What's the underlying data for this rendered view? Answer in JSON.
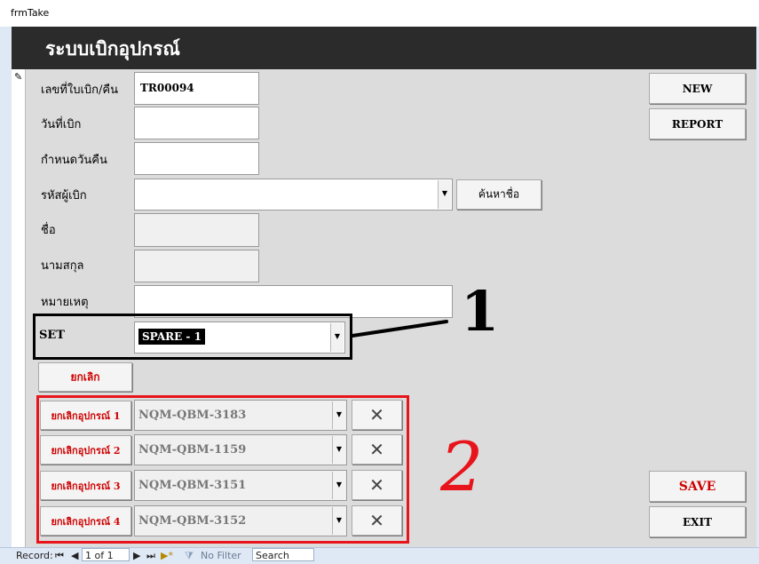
{
  "window": {
    "title": "frmTake"
  },
  "form": {
    "header_title": "ระบบเบิกอุปกรณ์",
    "record_indicator": "✎"
  },
  "fields": {
    "doc_no": {
      "label": "เลขที่ใบเบิก/คืน",
      "value": "TR00094"
    },
    "issue_date": {
      "label": "วันที่เบิก",
      "value": ""
    },
    "return_date": {
      "label": "กำหนดวันคืน",
      "value": ""
    },
    "borrower_code": {
      "label": "รหัสผู้เบิก",
      "value": ""
    },
    "first_name": {
      "label": "ชื่อ",
      "value": ""
    },
    "last_name": {
      "label": "นามสกุล",
      "value": ""
    },
    "remark": {
      "label": "หมายเหตุ",
      "value": ""
    },
    "set": {
      "label": "SET",
      "value": "SPARE - 1"
    }
  },
  "buttons": {
    "search_name": "ค้นหาชื่อ",
    "cancel": "ยกเลิก",
    "new": "NEW",
    "report": "REPORT",
    "save": "SAVE",
    "exit": "EXIT",
    "remove": "✕"
  },
  "equipment_rows": [
    {
      "cancel_label": "ยกเลิกอุปกรณ์ 1",
      "value": "NQM-QBM-3183"
    },
    {
      "cancel_label": "ยกเลิกอุปกรณ์ 2",
      "value": "NQM-QBM-1159"
    },
    {
      "cancel_label": "ยกเลิกอุปกรณ์ 3",
      "value": "NQM-QBM-3151"
    },
    {
      "cancel_label": "ยกเลิกอุปกรณ์ 4",
      "value": "NQM-QBM-3152"
    }
  ],
  "status_bar": {
    "record_label": "Record:",
    "record_position": "1 of 1",
    "filter_label": "No Filter",
    "search_label": "Search",
    "nav_first": "⏮",
    "nav_prev": "◀",
    "nav_next": "▶",
    "nav_last": "⏭",
    "nav_new": "▶*"
  },
  "annotations": {
    "label_1": "1",
    "label_2": "2"
  },
  "colors": {
    "header_bg": "#2b2b2b",
    "detail_bg": "#dcdcdc",
    "annotation_red": "#e8141b",
    "button_red_text": "#d00000"
  }
}
